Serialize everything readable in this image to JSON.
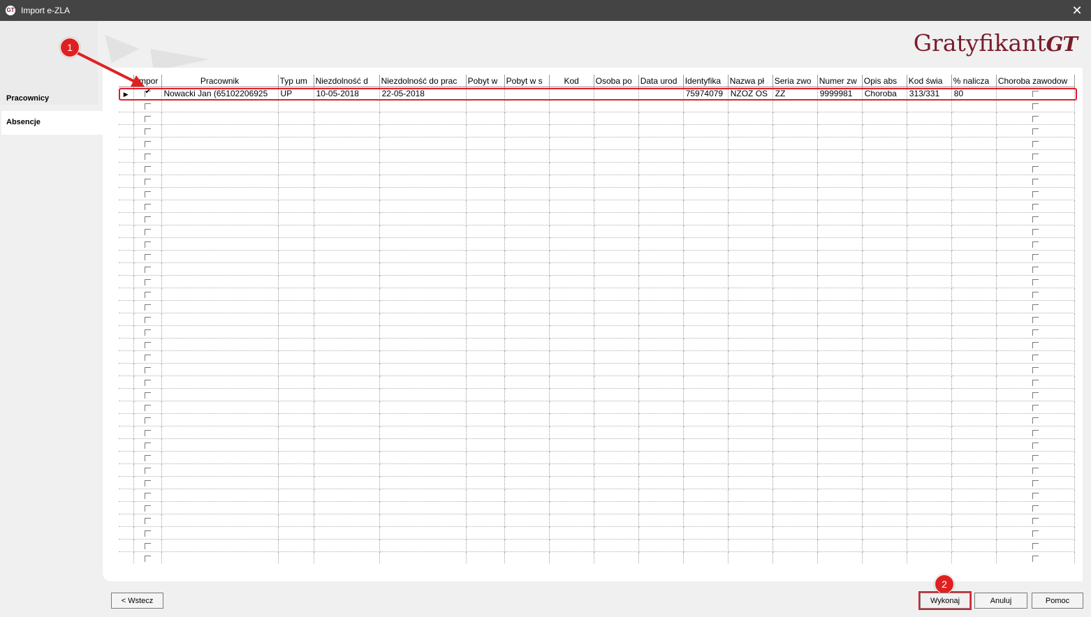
{
  "window": {
    "title": "Import e-ZLA",
    "close_glyph": "✕",
    "app_icon_text": "GT"
  },
  "logo": {
    "brand": "Gratyfikant",
    "suffix": "GT"
  },
  "sidebar": {
    "items": [
      {
        "label": "Pracownicy",
        "active": false
      },
      {
        "label": "Absencje",
        "active": true
      }
    ]
  },
  "grid": {
    "columns": [
      "",
      "Impor",
      "Pracownik",
      "Typ um",
      "Niezdolność d",
      "Niezdolność do prac",
      "Pobyt w",
      "Pobyt w s",
      "Kod",
      "Osoba po",
      "Data urod",
      "Identyfika",
      "Nazwa pł",
      "Seria zwo",
      "Numer zw",
      "Opis abs",
      "Kod świa",
      "% nalicza",
      "Choroba zawodow"
    ],
    "rows": [
      {
        "current": true,
        "import": true,
        "pracownik": "Nowacki Jan (65102206925",
        "typ_um": "UP",
        "niezdolnosc_od": "10-05-2018",
        "niezdolnosc_do": "22-05-2018",
        "pobyt_w": "",
        "pobyt_ws": "",
        "kod": "",
        "osoba_po": "",
        "data_urod": "",
        "identyfikator": "75974079",
        "nazwa_pl": "NZOZ OS",
        "seria": "ZZ",
        "numer": "9999981",
        "opis_abs": "Choroba",
        "kod_swiadczenia": "313/331",
        "procent": "80",
        "choroba_zawodowa": false
      }
    ],
    "empty_row_count": 37
  },
  "annotations": {
    "badge_1": "1",
    "badge_2": "2",
    "colors": {
      "annotation_red": "#e11d2a",
      "brand": "#7a1c2b"
    }
  },
  "buttons": {
    "back": "< Wstecz",
    "execute": "Wykonaj",
    "cancel": "Anuluj",
    "help": "Pomoc"
  }
}
